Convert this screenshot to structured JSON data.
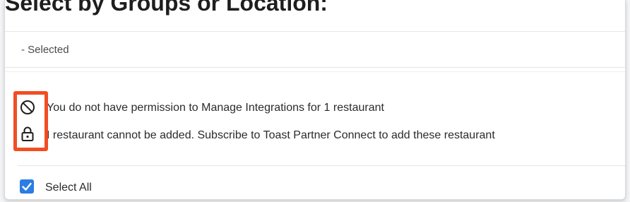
{
  "section": {
    "title": "Select by Groups or Location:"
  },
  "selection": {
    "summary": "- Selected"
  },
  "notices": {
    "permission_text": "You do not have permission to Manage Integrations for 1 restaurant",
    "permission_icon": "no-entry-icon",
    "subscription_text": "I restaurant cannot be added. Subscribe to Toast Partner Connect to add these restaurant",
    "subscription_icon": "lock-icon"
  },
  "select_all": {
    "label": "Select All",
    "checked": true
  },
  "colors": {
    "accent": "#2b7de1",
    "highlight": "#f04e23"
  }
}
